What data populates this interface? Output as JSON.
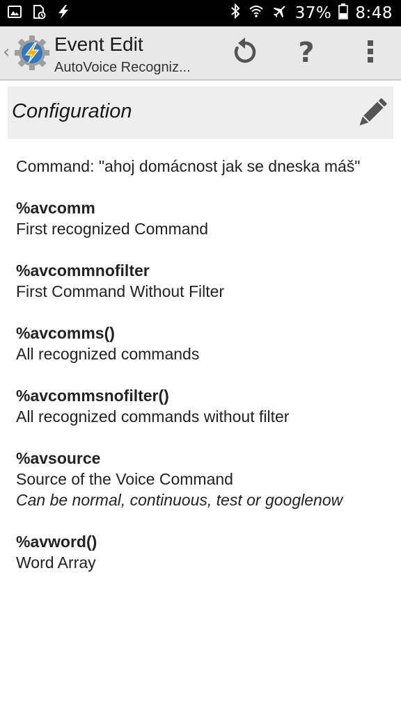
{
  "status_bar": {
    "battery_percent": "37%",
    "time": "8:48",
    "icons": [
      "image-icon",
      "sd-card-icon",
      "bolt-icon",
      "bluetooth-icon",
      "wifi-icon",
      "airplane-icon",
      "battery-icon"
    ]
  },
  "action_bar": {
    "title": "Event Edit",
    "subtitle": "AutoVoice Recogniz...",
    "back_glyph": "‹",
    "help_glyph": "?",
    "icons": [
      "tasker-logo-icon",
      "undo-icon",
      "help-icon",
      "overflow-menu-icon"
    ]
  },
  "config": {
    "title": "Configuration",
    "edit_icon": "pencil-icon"
  },
  "content": {
    "command": "Command: \"ahoj domácnost jak se dneska máš\"",
    "variables": [
      {
        "name": "%avcomm",
        "desc": "First recognized Command",
        "note": ""
      },
      {
        "name": "%avcommnofilter",
        "desc": "First Command Without Filter",
        "note": ""
      },
      {
        "name": "%avcomms()",
        "desc": "All recognized commands",
        "note": ""
      },
      {
        "name": "%avcommsnofilter()",
        "desc": "All recognized commands without filter",
        "note": ""
      },
      {
        "name": "%avsource",
        "desc": "Source of the Voice Command",
        "note": "Can be normal, continuous, test or googlenow"
      },
      {
        "name": "%avword()",
        "desc": "Word Array",
        "note": ""
      }
    ]
  },
  "colors": {
    "status_bar_bg": "#000000",
    "action_bar_bg": "#e8e8e8",
    "config_header_bg": "#eeeeee",
    "icon_gray": "#555555",
    "logo_yellow": "#f2b400",
    "logo_blue": "#2f78c4"
  }
}
